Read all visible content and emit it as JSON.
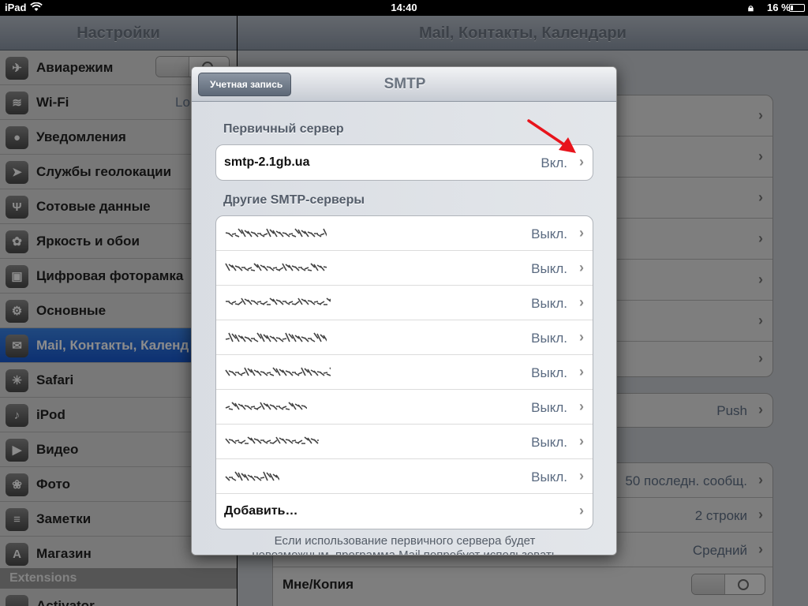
{
  "status": {
    "device": "iPad",
    "time": "14:40",
    "battery": "16 %"
  },
  "left": {
    "title": "Настройки",
    "items": [
      {
        "label": "Авиарежим",
        "icon": "airplane-icon",
        "glyph": "✈",
        "toggle": true
      },
      {
        "label": "Wi-Fi",
        "icon": "wifi-icon",
        "glyph": "≋",
        "value": "Lo"
      },
      {
        "label": "Уведомления",
        "icon": "notifications-icon",
        "glyph": "●"
      },
      {
        "label": "Службы геолокации",
        "icon": "location-icon",
        "glyph": "➤"
      },
      {
        "label": "Сотовые данные",
        "icon": "antenna-icon",
        "glyph": "Ψ"
      },
      {
        "label": "Яркость и обои",
        "icon": "flower-icon",
        "glyph": "✿"
      },
      {
        "label": "Цифровая фоторамка",
        "icon": "picture-frame-icon",
        "glyph": "▣"
      },
      {
        "label": "Основные",
        "icon": "gear-icon",
        "glyph": "⚙"
      },
      {
        "label": "Mail, Контакты, Календ",
        "icon": "mail-icon",
        "glyph": "✉",
        "selected": true
      },
      {
        "label": "Safari",
        "icon": "compass-icon",
        "glyph": "✳"
      },
      {
        "label": "iPod",
        "icon": "ipod-icon",
        "glyph": "♪"
      },
      {
        "label": "Видео",
        "icon": "clapper-icon",
        "glyph": "▶"
      },
      {
        "label": "Фото",
        "icon": "sunflower-icon",
        "glyph": "❀"
      },
      {
        "label": "Заметки",
        "icon": "notepad-icon",
        "glyph": "≡"
      },
      {
        "label": "Магазин",
        "icon": "app-store-icon",
        "glyph": "A"
      }
    ],
    "section": "Extensions",
    "extra_item": "Activator"
  },
  "right": {
    "title": "Mail, Контакты, Календари",
    "push_value": "Push",
    "show_value": "50 последн. сообщ.",
    "preview_value": "2 строки",
    "font_value": "Средний",
    "cc_label": "Мне/Копия"
  },
  "modal": {
    "title": "SMTP",
    "back": "Учетная запись",
    "primary_header": "Первичный сервер",
    "primary_server": "smtp-2.1gb.ua",
    "primary_value": "Вкл.",
    "others_header": "Другие SMTP-серверы",
    "other_values": [
      "Выкл.",
      "Выкл.",
      "Выкл.",
      "Выкл.",
      "Выкл.",
      "Выкл.",
      "Выкл.",
      "Выкл."
    ],
    "add_label": "Добавить…",
    "footer_line1": "Если использование первичного сервера будет",
    "footer_line2": "невозможным, программа Mail попробует использовать"
  },
  "colors": {
    "accent": "#1859cf",
    "annotation_arrow": "#e8141c"
  }
}
